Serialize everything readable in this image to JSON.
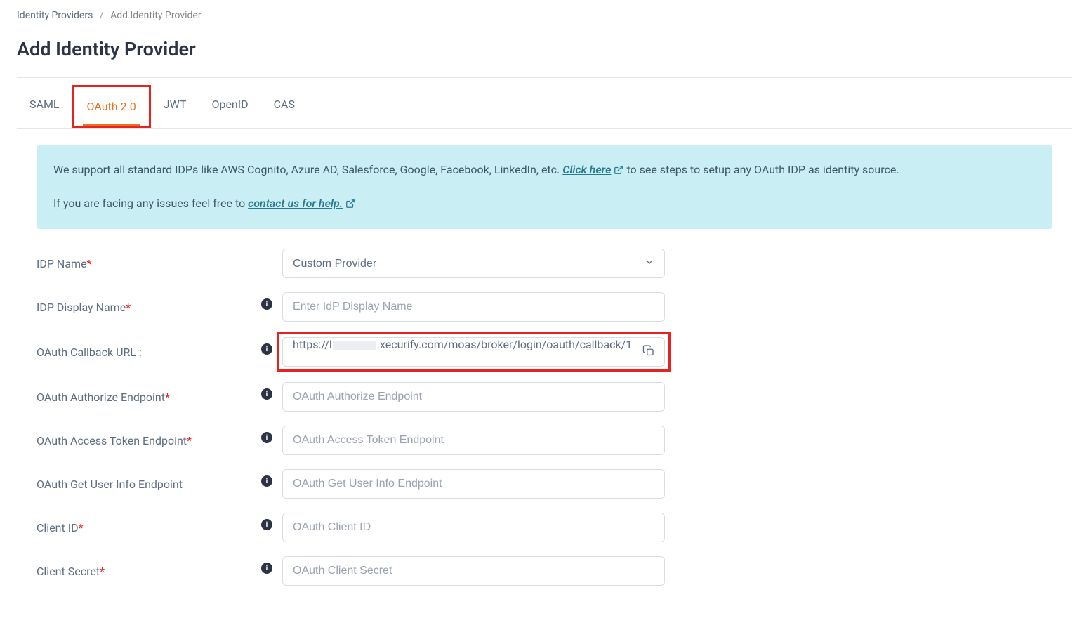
{
  "breadcrumb": {
    "parent": "Identity Providers",
    "current": "Add Identity Provider"
  },
  "page_title": "Add Identity Provider",
  "tabs": [
    {
      "id": "saml",
      "label": "SAML",
      "active": false
    },
    {
      "id": "oauth",
      "label": "OAuth 2.0",
      "active": true
    },
    {
      "id": "jwt",
      "label": "JWT",
      "active": false
    },
    {
      "id": "openid",
      "label": "OpenID",
      "active": false
    },
    {
      "id": "cas",
      "label": "CAS",
      "active": false
    }
  ],
  "info": {
    "line1_prefix": "We support all standard IDPs like AWS Cognito, Azure AD, Salesforce, Google, Facebook, LinkedIn, etc. ",
    "line1_link": "Click here",
    "line1_suffix": " to see steps to setup any OAuth IDP as identity source.",
    "line2_prefix": "If you are facing any issues feel free to ",
    "line2_link": "contact us for help."
  },
  "form": {
    "idp_name": {
      "label": "IDP Name",
      "value": "Custom Provider"
    },
    "idp_display_name": {
      "label": "IDP Display Name",
      "placeholder": "Enter IdP Display Name",
      "value": ""
    },
    "callback": {
      "label": "OAuth Callback URL :",
      "value_prefix": "https://l",
      "value_suffix": ".xecurify.com/moas/broker/login/oauth/callback/1"
    },
    "authorize": {
      "label": "OAuth Authorize Endpoint",
      "placeholder": "OAuth Authorize Endpoint",
      "value": ""
    },
    "token": {
      "label": "OAuth Access Token Endpoint",
      "placeholder": "OAuth Access Token Endpoint",
      "value": ""
    },
    "userinfo": {
      "label": "OAuth Get User Info Endpoint",
      "placeholder": "OAuth Get User Info Endpoint",
      "value": ""
    },
    "client_id": {
      "label": "Client ID",
      "placeholder": "OAuth Client ID",
      "value": ""
    },
    "client_secret": {
      "label": "Client Secret",
      "placeholder": "OAuth Client Secret",
      "value": ""
    }
  }
}
